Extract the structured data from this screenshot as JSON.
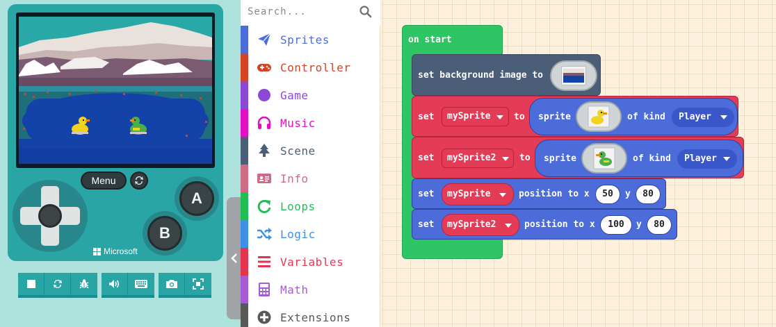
{
  "simulator": {
    "menu_label": "Menu",
    "button_a": "A",
    "button_b": "B",
    "brand": "Microsoft",
    "toolbar": [
      "stop-icon",
      "restart-icon",
      "debug-icon",
      "sound-icon",
      "keyboard-icon",
      "screenshot-icon",
      "fullscreen-icon"
    ]
  },
  "toolbox": {
    "search_placeholder": "Search...",
    "categories": [
      {
        "label": "Sprites",
        "color": "#4b6cd9",
        "icon": "paper-plane-icon"
      },
      {
        "label": "Controller",
        "color": "#d54322",
        "icon": "gamepad-icon"
      },
      {
        "label": "Game",
        "color": "#8b48d5",
        "icon": "circle-icon"
      },
      {
        "label": "Music",
        "color": "#e30fc0",
        "icon": "headphones-icon"
      },
      {
        "label": "Scene",
        "color": "#4b5e78",
        "icon": "tree-icon"
      },
      {
        "label": "Info",
        "color": "#cf6a87",
        "icon": "id-card-icon"
      },
      {
        "label": "Loops",
        "color": "#20bf55",
        "icon": "loop-icon"
      },
      {
        "label": "Logic",
        "color": "#3e8fe6",
        "icon": "shuffle-icon"
      },
      {
        "label": "Variables",
        "color": "#e4344f",
        "icon": "list-icon"
      },
      {
        "label": "Math",
        "color": "#a35bd6",
        "icon": "calculator-icon"
      },
      {
        "label": "Extensions",
        "color": "#585858",
        "icon": "plus-circle-icon"
      }
    ]
  },
  "workspace": {
    "on_start": "on start",
    "bg_set": "set background image to",
    "set": "set",
    "to": "to",
    "sprite": "sprite",
    "of_kind": "of kind",
    "position_to_x": "position to x",
    "y": "y",
    "var1": "mySprite",
    "var2": "mySprite2",
    "kind1": "Player",
    "kind2": "Player",
    "pos1": {
      "x": "50",
      "y": "80"
    },
    "pos2": {
      "x": "100",
      "y": "80"
    }
  },
  "colors": {
    "sim_bg": "#ade3dc",
    "device": "#2aa5a5",
    "on_start": "#2ec665",
    "scene_block": "#4b5e78",
    "variables_block": "#e43b57",
    "sprites_block": "#4b6cd9"
  }
}
